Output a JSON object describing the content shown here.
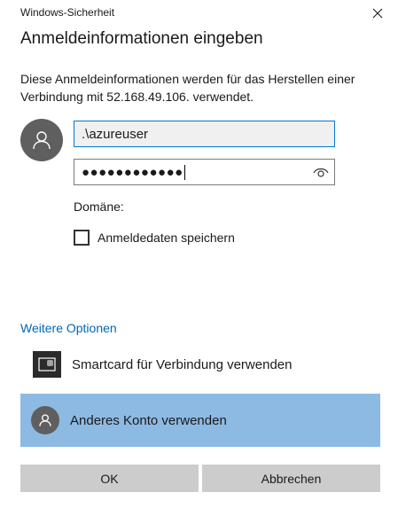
{
  "window": {
    "title": "Windows-Sicherheit",
    "close_icon": "close-icon"
  },
  "dialog": {
    "heading": "Anmeldeinformationen eingeben",
    "description": "Diese Anmeldeinformationen werden für das Herstellen einer Verbindung mit 52.168.49.106. verwendet."
  },
  "form": {
    "username_value": ".\\azureuser",
    "password_masked": "●●●●●●●●●●●●",
    "domain_label": "Domäne:",
    "remember_label": "Anmeldedaten speichern",
    "remember_checked": false
  },
  "options": {
    "more_label": "Weitere Optionen",
    "smartcard_label": "Smartcard für Verbindung verwenden",
    "other_account_label": "Anderes Konto verwenden",
    "selected_color": "#8dbae3"
  },
  "buttons": {
    "ok_label": "OK",
    "cancel_label": "Abbrechen"
  },
  "colors": {
    "accent": "#0078d7",
    "link": "#0067b8",
    "button_bg": "#cccccc"
  }
}
